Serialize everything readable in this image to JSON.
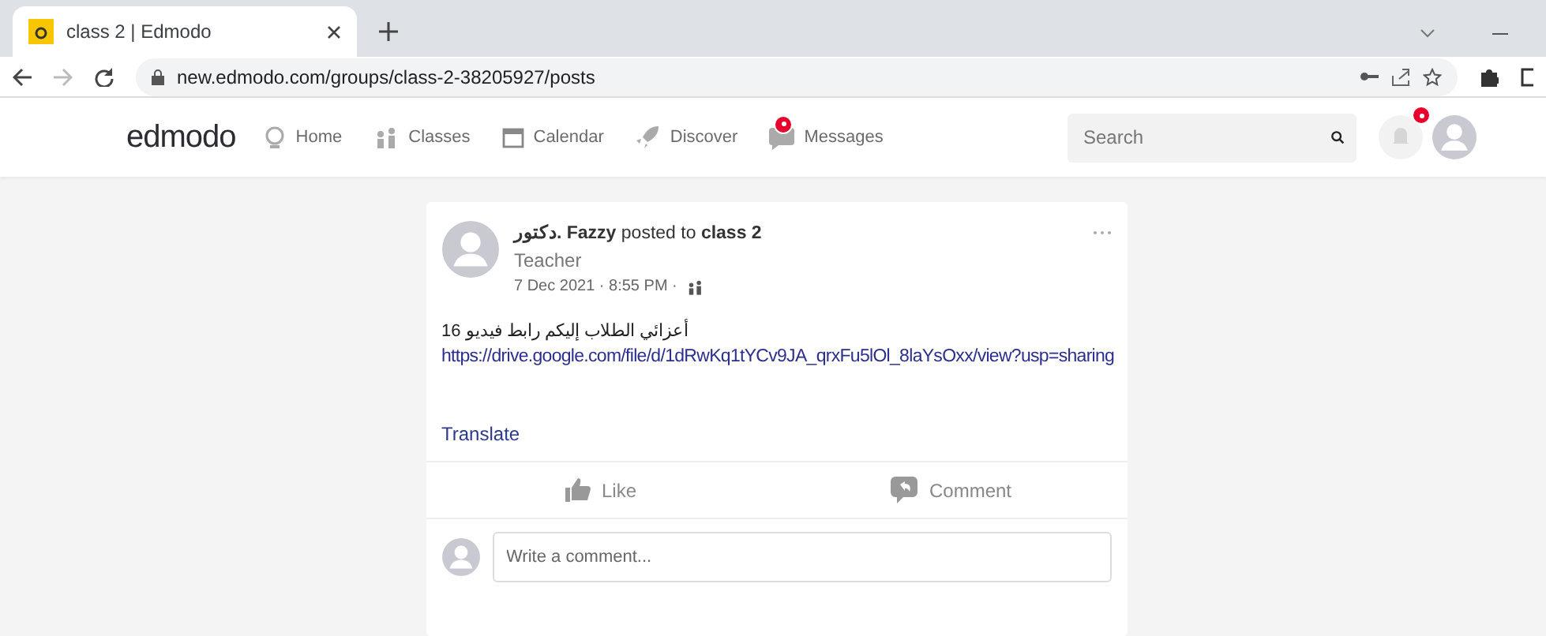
{
  "browser": {
    "tabs": [
      {
        "title": "class 2 | Edmodo",
        "selected": true
      }
    ],
    "url": "new.edmodo.com/groups/class-2-38205927/posts"
  },
  "nav": {
    "logo": "edmodo",
    "items": [
      {
        "label": "Home",
        "kind": "home",
        "badge": false
      },
      {
        "label": "Classes",
        "kind": "classes",
        "badge": false
      },
      {
        "label": "Calendar",
        "kind": "calendar",
        "badge": false
      },
      {
        "label": "Discover",
        "kind": "discover",
        "badge": false
      },
      {
        "label": "Messages",
        "kind": "messages",
        "badge": true
      }
    ],
    "search": {
      "placeholder": "Search"
    },
    "notifications_badge": true
  },
  "post": {
    "author_line": "**دكتور. Fazzy** posted to **class 2**",
    "role": "Teacher",
    "date": "7 Dec 2021 · 8:55 PM ·",
    "text": "أعزائي الطلاب إليكم رابط فيديو 16",
    "link": "https://drive.google.com/file/d/1dRwKq1tYCv9JA_qrxFu5lOl_8laYsOxx/view?usp=sharing",
    "translate": "Translate",
    "actions": [
      {
        "label": "Like",
        "kind": "like"
      },
      {
        "label": "Comment",
        "kind": "comment"
      }
    ],
    "comment": {
      "placeholder": "Write a comment..."
    }
  }
}
